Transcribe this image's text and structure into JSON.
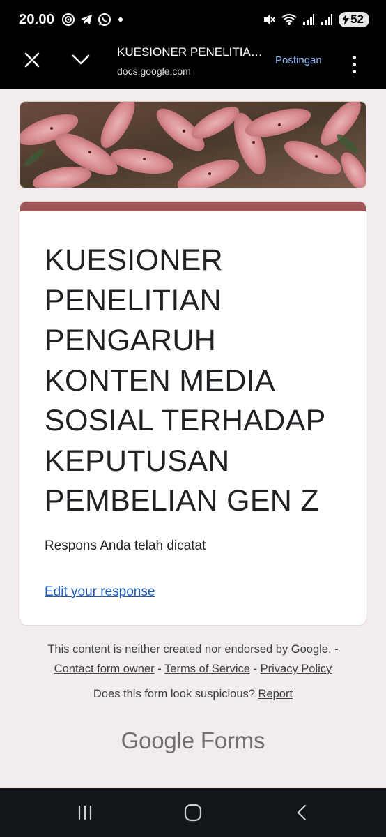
{
  "status_bar": {
    "time": "20.00",
    "battery": "52",
    "icons": [
      "settings-ring-icon",
      "telegram-icon",
      "whatsapp-icon",
      "notification-dot",
      "mute-icon",
      "wifi-icon",
      "signal-icon",
      "signal-icon",
      "charging-icon"
    ]
  },
  "browser": {
    "title": "KUESIONER PENELITIAN PENGARUH KONTEN MEDIA SOSIAL TERHADAP KEPUTUSAN PEMBELIAN GEN Z",
    "url": "docs.google.com",
    "action_label": "Postingan",
    "close_icon": "close-icon",
    "collapse_icon": "chevron-down-icon",
    "menu_icon": "more-vert-icon"
  },
  "form": {
    "title": "KUESIONER PENELITIAN PENGARUH KONTEN MEDIA SOSIAL TERHADAP KEPUTUSAN PEMBELIAN GEN Z",
    "response_message": "Respons Anda telah dicatat",
    "edit_link": "Edit your response",
    "accent_color": "#9e5555"
  },
  "footer": {
    "disclaimer": "This content is neither created nor endorsed by Google. -",
    "contact_owner": "Contact form owner",
    "separator": "-",
    "terms": "Terms of Service",
    "privacy": "Privacy Policy",
    "suspicious_question": "Does this form look suspicious?",
    "report": "Report",
    "logo_google": "Google",
    "logo_forms": "Forms"
  },
  "nav_bar": {
    "buttons": [
      "recent-apps-icon",
      "home-icon",
      "back-icon"
    ]
  }
}
